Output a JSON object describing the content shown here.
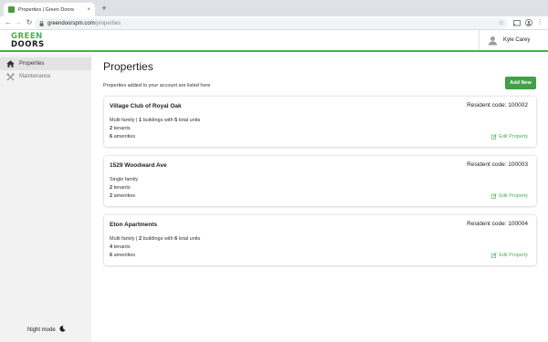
{
  "browser": {
    "tab_title": "Properties | Green Doors",
    "tab_close": "×",
    "new_tab": "+",
    "url_host": "greendoorspm.com",
    "url_path": "/properties"
  },
  "header": {
    "logo_top": "GREEN",
    "logo_bottom": "DOORS",
    "user_name": "Kyle Carey"
  },
  "sidebar": {
    "items": [
      {
        "label": "Properties",
        "icon": "home-icon",
        "active": true
      },
      {
        "label": "Maintenance",
        "icon": "tools-icon",
        "active": false
      }
    ],
    "night_mode_label": "Night mode"
  },
  "main": {
    "title": "Properties",
    "subtitle": "Properties added to your account are listed here",
    "add_button": "Add New",
    "edit_label": "Edit Property",
    "properties": [
      {
        "name": "Village Club of Royal Oak",
        "resident_code": "Resident code: 100002",
        "type": "Multi family",
        "buildings": "1",
        "units": "5",
        "tenants": "2",
        "amenities": "6"
      },
      {
        "name": "1529 Woodward Ave",
        "resident_code": "Resident code: 100003",
        "type": "Single family",
        "tenants": "2",
        "amenities": "2"
      },
      {
        "name": "Eton Apartments",
        "resident_code": "Resident code: 100004",
        "type": "Multi family",
        "buildings": "2",
        "units": "6",
        "tenants": "4",
        "amenities": "6"
      }
    ],
    "text": {
      "sep": " | ",
      "buildings_with": " buildings with ",
      "total_units": " total units",
      "tenants": " tenants",
      "amenities": " amenities"
    }
  },
  "colors": {
    "brand_green": "#4caf50",
    "button_green": "#43a047",
    "sidebar_bg": "#f2f2f2"
  }
}
